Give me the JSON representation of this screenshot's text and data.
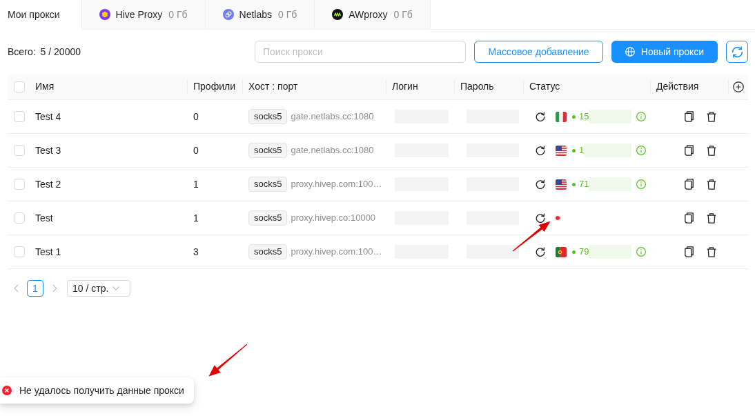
{
  "tabs": [
    {
      "kind": "plain",
      "label": "Мои прокси",
      "selected": true
    },
    {
      "kind": "hive",
      "label": "Hive Proxy",
      "usage": "0 Гб",
      "selected": false
    },
    {
      "kind": "netlabs",
      "label": "Netlabs",
      "usage": "0 Гб",
      "selected": false
    },
    {
      "kind": "aw",
      "label": "AWproxy",
      "usage": "0 Гб",
      "selected": false
    }
  ],
  "toolbar": {
    "total_label": "Всего:",
    "total_value": "5 / 20000",
    "search": {
      "placeholder": "Поиск прокси"
    },
    "bulk_add_button": "Массовое добавление",
    "new_proxy_button": "Новый прокси"
  },
  "table": {
    "header_checkbox": {
      "checked": false
    },
    "columns": [
      "Имя",
      "Профили",
      "Хост : порт",
      "Логин",
      "Пароль",
      "Статус",
      "Действия"
    ],
    "rows": [
      {
        "selected": false,
        "name": "Test 4",
        "profiles": "0",
        "protocol": "socks5",
        "host": "gate.netlabs.cc:1080",
        "online": true,
        "flag": {
          "kind": "it"
        },
        "ip": "15"
      },
      {
        "selected": false,
        "name": "Test 3",
        "profiles": "0",
        "protocol": "socks5",
        "host": "gate.netlabs.cc:1080",
        "online": true,
        "flag": {
          "kind": "us"
        },
        "ip": "1"
      },
      {
        "selected": false,
        "name": "Test 2",
        "profiles": "1",
        "protocol": "socks5",
        "host": "proxy.hivep.com:100…",
        "online": true,
        "flag": {
          "kind": "us"
        },
        "ip": "71"
      },
      {
        "selected": false,
        "name": "Test",
        "profiles": "1",
        "protocol": "socks5",
        "host": "proxy.hivep.co:10000",
        "online": false
      },
      {
        "selected": false,
        "name": "Test 1",
        "profiles": "3",
        "protocol": "socks5",
        "host": "proxy.hivep.com:100…",
        "online": true,
        "flag": {
          "kind": "pt"
        },
        "ip": "79"
      }
    ]
  },
  "pagination": {
    "prev": {
      "disabled": true
    },
    "pages": [
      {
        "label": "1",
        "selected": true
      }
    ],
    "next": {
      "disabled": true
    },
    "page_size": "10 / стр."
  },
  "toast": {
    "kind": "error",
    "message": "Не удалось получить данные прокси"
  }
}
